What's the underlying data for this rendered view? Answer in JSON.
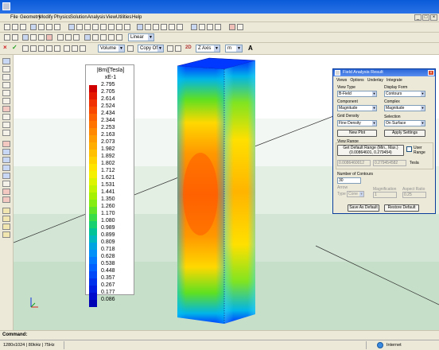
{
  "menu": [
    "File",
    "Geometry",
    "Modify",
    "Physics",
    "Solution",
    "Analysis",
    "View",
    "Utilities",
    "Help"
  ],
  "toolbar": {
    "linear_combo": "Linear",
    "volume_combo": "Volume",
    "copyoff_combo": "Copy Off",
    "zaxis_combo": "Z Axis",
    "unit_combo": "m",
    "label_2d": "2D",
    "label_a": "A"
  },
  "legend": {
    "unit": "|Bm|[Tesla]",
    "multiplier": "xE-1",
    "values": [
      "2.795",
      "2.705",
      "2.614",
      "2.524",
      "2.434",
      "2.344",
      "2.253",
      "2.163",
      "2.073",
      "1.982",
      "1.892",
      "1.802",
      "1.712",
      "1.621",
      "1.531",
      "1.441",
      "1.350",
      "1.260",
      "1.170",
      "1.080",
      "0.989",
      "0.899",
      "0.809",
      "0.718",
      "0.628",
      "0.538",
      "0.448",
      "0.357",
      "0.267",
      "0.177",
      "0.086"
    ],
    "colors": [
      "#d00000",
      "#e41800",
      "#f03000",
      "#f84800",
      "#fc6000",
      "#ff7400",
      "#ff8800",
      "#ff9c00",
      "#ffae00",
      "#ffc000",
      "#ffd200",
      "#ffe400",
      "#f4f000",
      "#dcf400",
      "#c0f400",
      "#a4f000",
      "#84ec10",
      "#60e428",
      "#38dc48",
      "#18d070",
      "#00c498",
      "#00b8c0",
      "#00a4e0",
      "#0090f8",
      "#0078ff",
      "#0060ff",
      "#0048f8",
      "#0030ec",
      "#001ce0",
      "#000ccc",
      "#0000b4"
    ]
  },
  "dialog": {
    "title": "Field Analysis Result",
    "menu": [
      "Views",
      "Options",
      "Underlay",
      "Integrate"
    ],
    "view_type_label": "View Type",
    "view_type_value": "B-Field",
    "display_form_label": "Display Form",
    "display_form_value": "Contours",
    "component_label": "Component",
    "component_value": "Magnitude",
    "complex_label": "Complex",
    "complex_value": "Magnitude",
    "grid_density_label": "Grid Density",
    "grid_density_value": "Fine Density",
    "selection_label": "Selection",
    "selection_value": "On Surface",
    "new_plot": "New Plot",
    "apply_settings": "Apply Settings",
    "view_range_label": "View Range",
    "default_range_text": "Get Default Range (Min., Max.)",
    "default_range_values": "(0.00864601, 0.279454)",
    "user_range_label": "User Range",
    "range_min": "0.0086460012",
    "range_max": "0.279454582",
    "tesla": "Tesla",
    "contours_label": "Number of Contours",
    "contours_value": "30",
    "arrow_label": "Arrow",
    "type_label": "Type",
    "type_value": "Cone",
    "magnification_label": "Magnification",
    "magnification_value": "1",
    "aspect_label": "Aspect Ratio",
    "aspect_value": "0.25",
    "save_default": "Save As Default",
    "restore_default": "Restore Default"
  },
  "command": {
    "label": "Command:"
  },
  "status": {
    "resolution": "1280x1024 | 80kHz | 75Hz",
    "zone": "Internet"
  }
}
